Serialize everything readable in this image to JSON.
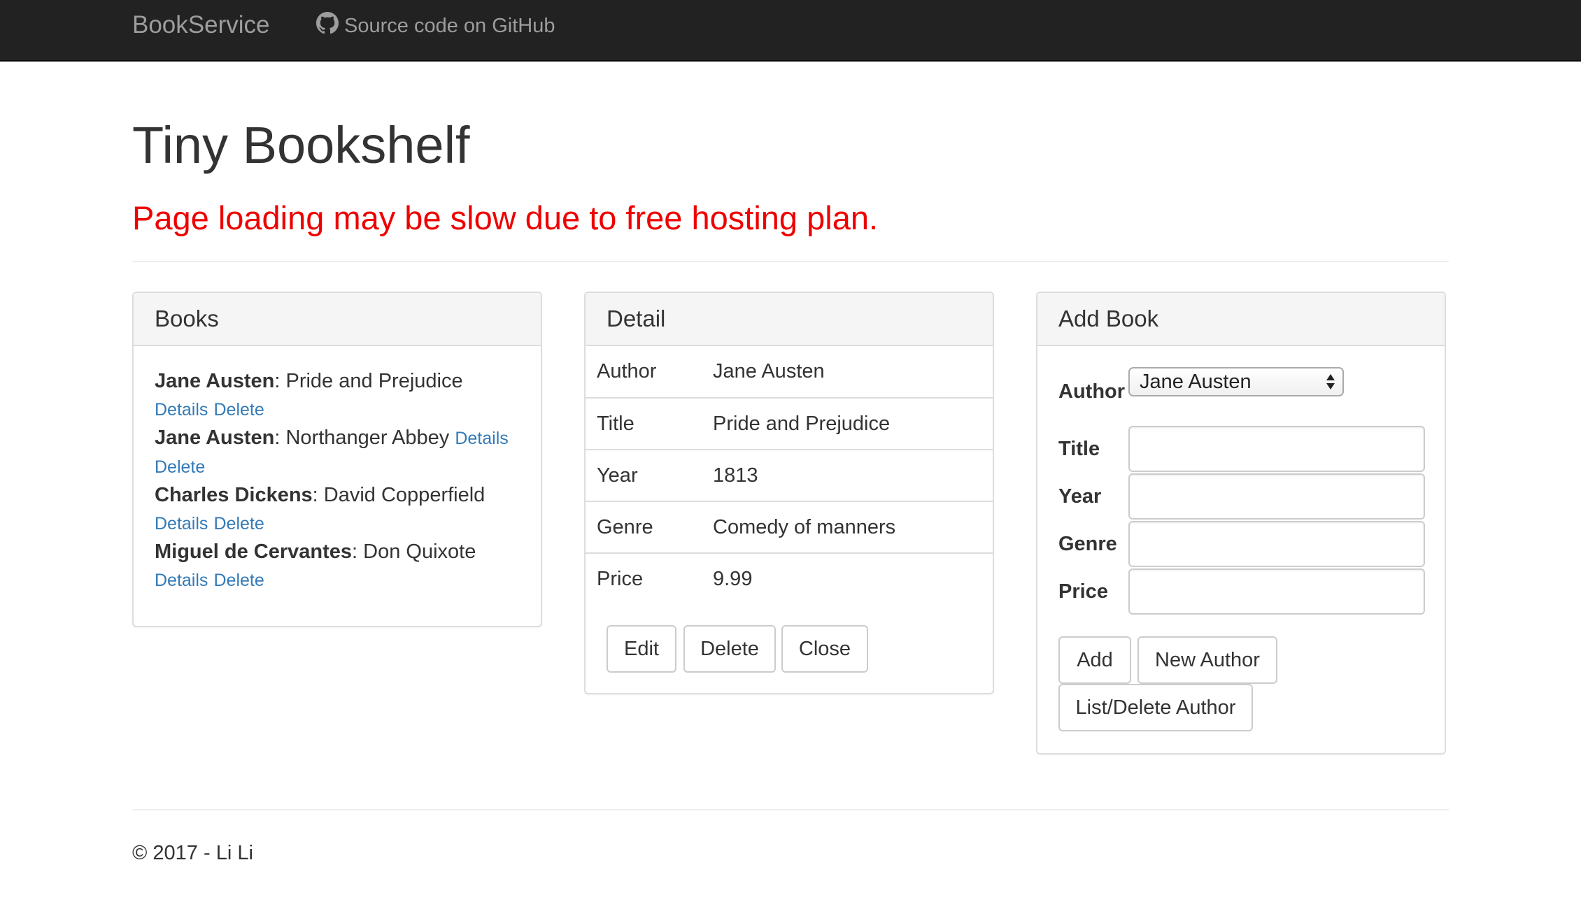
{
  "navbar": {
    "brand": "BookService",
    "github_link": "Source code on GitHub",
    "github_icon": "github-icon"
  },
  "header": {
    "title": "Tiny Bookshelf",
    "warning": "Page loading may be slow due to free hosting plan.",
    "warning_color": "#ee0000"
  },
  "books": {
    "heading": "Books",
    "items": [
      {
        "author": "Jane Austen",
        "title": ": Pride and Prejudice",
        "details": "Details",
        "delete": "Delete"
      },
      {
        "author": "Jane Austen",
        "title": ": Northanger Abbey",
        "details": "Details",
        "delete": "Delete"
      },
      {
        "author": "Charles Dickens",
        "title": ": David Copperfield",
        "details": "Details",
        "delete": "Delete"
      },
      {
        "author": "Miguel de Cervantes",
        "title": ": Don Quixote",
        "details": "Details",
        "delete": "Delete"
      }
    ],
    "link_color": "#337ab7"
  },
  "detail": {
    "heading": "Detail",
    "rows": [
      {
        "label": "Author",
        "value": "Jane Austen"
      },
      {
        "label": "Title",
        "value": "Pride and Prejudice"
      },
      {
        "label": "Year",
        "value": "1813"
      },
      {
        "label": "Genre",
        "value": "Comedy of manners"
      },
      {
        "label": "Price",
        "value": "9.99"
      }
    ],
    "buttons": {
      "edit": "Edit",
      "delete": "Delete",
      "close": "Close"
    }
  },
  "add_book": {
    "heading": "Add Book",
    "author_label": "Author",
    "author_selected": "Jane Austen",
    "title_label": "Title",
    "year_label": "Year",
    "genre_label": "Genre",
    "price_label": "Price",
    "title_value": "",
    "year_value": "",
    "genre_value": "",
    "price_value": "",
    "buttons": {
      "add": "Add",
      "new_author": "New Author",
      "list_delete_author": "List/Delete Author"
    }
  },
  "footer": {
    "text": "© 2017 - Li Li"
  }
}
